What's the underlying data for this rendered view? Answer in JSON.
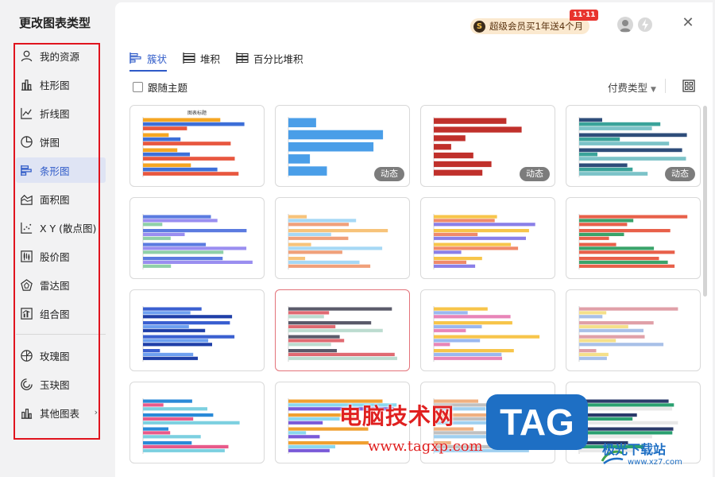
{
  "dialog": {
    "title": "更改图表类型"
  },
  "sidebar": {
    "items": [
      {
        "label": "我的资源"
      },
      {
        "label": "柱形图"
      },
      {
        "label": "折线图"
      },
      {
        "label": "饼图"
      },
      {
        "label": "条形图"
      },
      {
        "label": "面积图"
      },
      {
        "label": "X Y (散点图)"
      },
      {
        "label": "股价图"
      },
      {
        "label": "雷达图"
      },
      {
        "label": "组合图"
      },
      {
        "label": "玫瑰图"
      },
      {
        "label": "玉玦图"
      },
      {
        "label": "其他图表"
      }
    ],
    "active_index": 4
  },
  "header": {
    "promo_text": "超级会员买1年送4个月",
    "promo_tag": "11·11"
  },
  "tabs": [
    {
      "label": "簇状",
      "active": true
    },
    {
      "label": "堆积",
      "active": false
    },
    {
      "label": "百分比堆积",
      "active": false
    }
  ],
  "toolbar": {
    "follow_theme_label": "跟随主题",
    "pay_type_label": "付费类型"
  },
  "cards": [
    {
      "title": "图表标题",
      "badge": ""
    },
    {
      "title": "",
      "badge": "动态"
    },
    {
      "title": "",
      "badge": "动态"
    },
    {
      "title": "",
      "badge": "动态"
    },
    {
      "title": "",
      "badge": ""
    },
    {
      "title": "",
      "badge": ""
    },
    {
      "title": "",
      "badge": ""
    },
    {
      "title": "",
      "badge": ""
    },
    {
      "title": "",
      "badge": ""
    },
    {
      "title": "",
      "badge": ""
    },
    {
      "title": "",
      "badge": ""
    },
    {
      "title": "",
      "badge": ""
    },
    {
      "title": "",
      "badge": ""
    },
    {
      "title": "",
      "badge": ""
    },
    {
      "title": "",
      "badge": ""
    },
    {
      "title": "",
      "badge": ""
    }
  ],
  "watermark": {
    "text": "电脑技术网",
    "url": "www.tagxp.com",
    "tag": "TAG",
    "site": "极光下载站",
    "site_url": "www.xz7.com"
  },
  "colors": {
    "accent": "#2e5ac8",
    "highlight_box": "#e0141e",
    "watermark_red": "#e02020",
    "watermark_blue": "#1e6fc4"
  }
}
